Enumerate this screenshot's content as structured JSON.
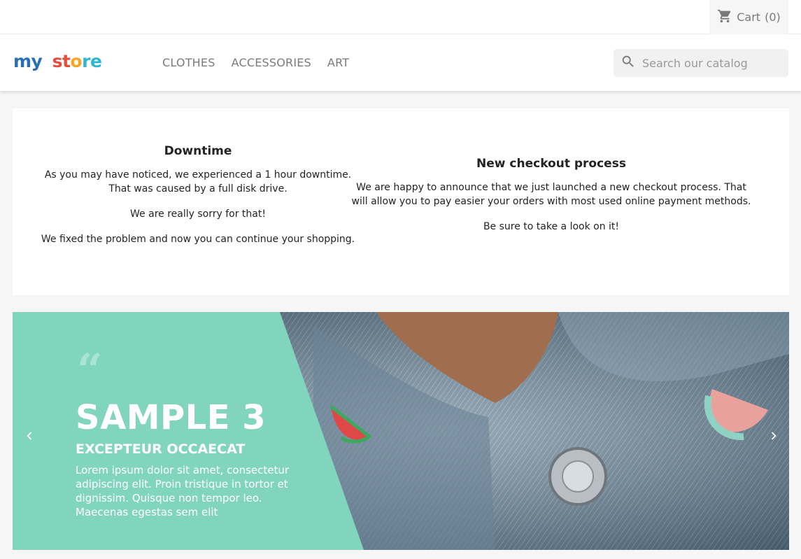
{
  "nav": {
    "cart_label": "Cart",
    "cart_count": "(0)"
  },
  "brand": {
    "logo_parts": [
      "my",
      "st",
      "o",
      "re"
    ]
  },
  "menu": {
    "items": [
      {
        "label": "CLOTHES"
      },
      {
        "label": "ACCESSORIES"
      },
      {
        "label": "ART"
      }
    ]
  },
  "search": {
    "placeholder": "Search our catalog"
  },
  "news": [
    {
      "title": "Downtime",
      "paragraphs": [
        "As you may have noticed, we experienced a 1 hour downtime. That was caused by a full disk drive.",
        "We are really sorry for that!",
        "We fixed the problem and now you can continue your shopping."
      ]
    },
    {
      "title": "New checkout process",
      "paragraphs": [
        "We are happy to announce that we just launched a new checkout process. That will allow you to pay easier your orders with most used online payment methods.",
        "Be sure to take a look on it!"
      ]
    }
  ],
  "slide": {
    "quote_mark": "“",
    "title": "SAMPLE 3",
    "subtitle": "EXCEPTEUR OCCAECAT",
    "text": "Lorem ipsum dolor sit amet, consectetur adipiscing elit. Proin tristique in tortor et dignissim. Quisque non tempor leo. Maecenas egestas sem elit"
  },
  "colors": {
    "accent_mint": "#81d5bc",
    "text_grey": "#7a7a7a",
    "denim": "#5b7487"
  },
  "icons": [
    "cart-icon",
    "search-icon",
    "chevron-left-icon",
    "chevron-right-icon"
  ]
}
